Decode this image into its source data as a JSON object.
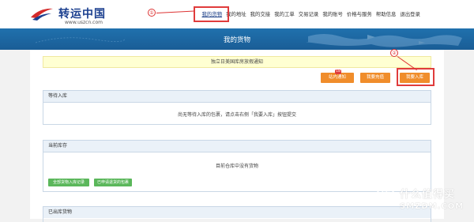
{
  "header": {
    "logo_text": "转运中国",
    "logo_url": "www.uszcn.com",
    "nav": [
      {
        "label": "我的货物"
      },
      {
        "label": "我的地址"
      },
      {
        "label": "我的交接"
      },
      {
        "label": "我的工单"
      },
      {
        "label": "交易记录"
      },
      {
        "label": "我的账号"
      },
      {
        "label": "价格与服务"
      },
      {
        "label": "帮助信息"
      },
      {
        "label": "退出登录"
      }
    ],
    "annotation_1": "①",
    "annotation_2": "②"
  },
  "banner": {
    "title": "我的货物"
  },
  "notice": {
    "text": "独立日美国库房放假通知"
  },
  "actions": {
    "inbox_label": "站内通知",
    "inbox_badge": "18",
    "recharge_label": "我要充值",
    "checkin_label": "我要入库"
  },
  "panels": {
    "pending": {
      "title": "等待入库",
      "empty_text": "尚无等待入库的包裹，请点击右侧「我要入库」按钮提交"
    },
    "stock": {
      "title": "当前库存",
      "empty_text": "目前仓库中没有货物",
      "btn_history": "全部货物入库记录",
      "btn_withdraw": "已申请退货的包裹"
    },
    "shipped": {
      "title": "已出库货物"
    }
  },
  "watermark": {
    "icon": "值",
    "line1": "什么值得买",
    "line2": "SMZDM.COM"
  },
  "colors": {
    "brand_blue": "#1b3f8f",
    "banner": "#2071ad",
    "orange": "#f08d2b",
    "green": "#5bb75b",
    "annotation_red": "#e03c3c"
  }
}
